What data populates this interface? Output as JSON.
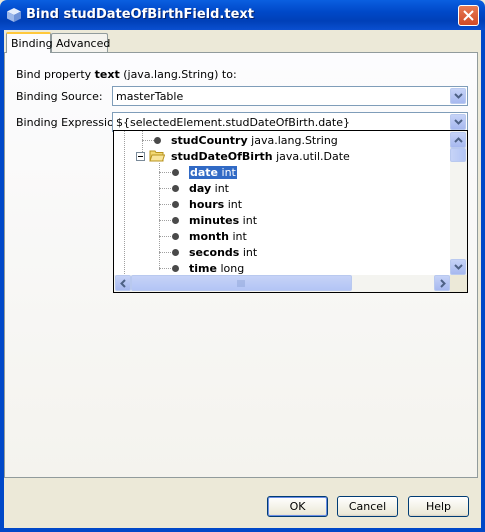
{
  "window": {
    "title": "Bind studDateOfBirthField.text"
  },
  "tabs": [
    {
      "label": "Binding",
      "active": true
    },
    {
      "label": "Advanced",
      "active": false
    }
  ],
  "bind_property": {
    "prefix": "Bind property ",
    "property": "text",
    "suffix": " (java.lang.String) to:"
  },
  "binding_source": {
    "label": "Binding Source:",
    "value": "masterTable"
  },
  "binding_expression": {
    "label": "Binding Expression:",
    "value": "${selectedElement.studDateOfBirth.date}"
  },
  "tree": {
    "items": [
      {
        "name": "studCountry",
        "type": "java.lang.String",
        "kind": "leaf"
      },
      {
        "name": "studDateOfBirth",
        "type": "java.util.Date",
        "kind": "folder-expanded"
      },
      {
        "name": "date",
        "type": "int",
        "kind": "leaf",
        "selected": true
      },
      {
        "name": "day",
        "type": "int",
        "kind": "leaf"
      },
      {
        "name": "hours",
        "type": "int",
        "kind": "leaf"
      },
      {
        "name": "minutes",
        "type": "int",
        "kind": "leaf"
      },
      {
        "name": "month",
        "type": "int",
        "kind": "leaf"
      },
      {
        "name": "seconds",
        "type": "int",
        "kind": "leaf"
      },
      {
        "name": "time",
        "type": "long",
        "kind": "leaf"
      }
    ]
  },
  "buttons": {
    "ok": "OK",
    "cancel": "Cancel",
    "help": "Help"
  },
  "colors": {
    "title_bar": "#0048c8",
    "selection": "#316ac5",
    "dialog_bg": "#ece9d8"
  }
}
